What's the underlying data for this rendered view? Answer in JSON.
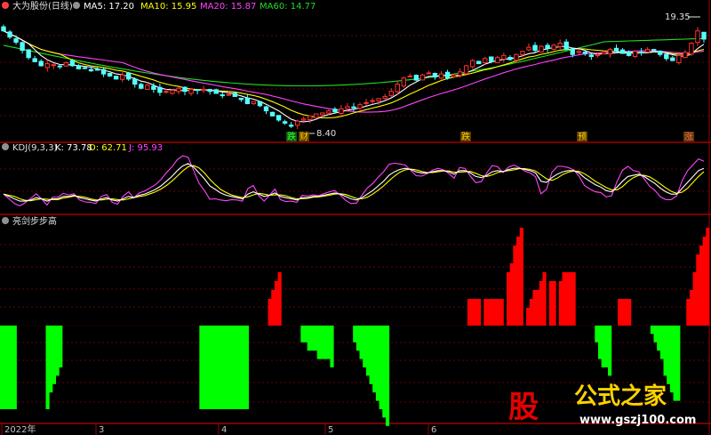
{
  "price_panel": {
    "title": "大为股份(日线)",
    "ma_labels": [
      {
        "text": "MA5: 17.20",
        "color": "#ffffff"
      },
      {
        "text": "MA10: 15.95",
        "color": "#ffff00"
      },
      {
        "text": "MA20: 15.87",
        "color": "#ff44ff"
      },
      {
        "text": "MA60: 14.77",
        "color": "#22dd22"
      }
    ],
    "high_label": "19.35",
    "low_label": "8.40",
    "event_markers": [
      "跌",
      "财",
      "跌",
      "预",
      "涨"
    ]
  },
  "kdj_panel": {
    "title": "KDJ(9,3,3)",
    "labels": [
      {
        "text": "K: 73.78",
        "color": "#ffffff"
      },
      {
        "text": "D: 62.71",
        "color": "#ffff00"
      },
      {
        "text": "J: 95.93",
        "color": "#ff44ff"
      }
    ]
  },
  "indicator_panel": {
    "title": "亮剑步步高"
  },
  "time_axis": [
    "2022年",
    "3",
    "4",
    "5",
    "6"
  ],
  "watermark": {
    "title": "公式之家",
    "url": "www.gszj100.com",
    "logo": "股"
  },
  "colors": {
    "up": "#ff3232",
    "down": "#54ffff",
    "hist_up": "#ff0000",
    "hist_down": "#00ff00",
    "grid": "#8b0000"
  },
  "chart_data": [
    {
      "type": "candlestick",
      "series_name": "大为股份(日线)",
      "x": "trading days, Jan 2022 - Jul 2022",
      "closes": [
        18.2,
        17.6,
        17.1,
        16.3,
        15.6,
        15.2,
        14.8,
        15.0,
        14.9,
        14.7,
        15.1,
        14.8,
        14.5,
        14.6,
        14.3,
        14.4,
        14.0,
        13.8,
        13.5,
        13.9,
        13.5,
        13.0,
        12.6,
        12.9,
        12.5,
        12.2,
        12.3,
        12.4,
        12.6,
        12.3,
        12.5,
        12.4,
        12.5,
        12.3,
        12.1,
        11.9,
        12.0,
        11.8,
        11.5,
        11.1,
        11.3,
        10.9,
        10.4,
        9.9,
        9.5,
        9.2,
        8.9,
        9.4,
        9.6,
        9.9,
        10.1,
        10.2,
        10.4,
        10.3,
        10.6,
        10.8,
        10.7,
        11.0,
        11.2,
        11.4,
        11.6,
        11.8,
        12.3,
        13.0,
        13.6,
        13.8,
        13.4,
        13.9,
        14.1,
        13.7,
        14.0,
        13.6,
        13.9,
        14.2,
        14.8,
        15.3,
        15.0,
        15.5,
        15.2,
        15.6,
        15.8,
        15.4,
        15.9,
        16.2,
        16.6,
        16.3,
        16.7,
        16.5,
        16.8,
        17.0,
        16.4,
        15.9,
        16.2,
        16.0,
        15.7,
        15.9,
        16.1,
        16.4,
        16.2,
        16.0,
        15.8,
        16.2,
        16.1,
        16.4,
        16.3,
        15.9,
        15.5,
        15.3,
        15.8,
        16.1,
        17.0,
        18.2,
        17.4
      ],
      "ma": {
        "MA5": 17.2,
        "MA10": 15.95,
        "MA20": 15.87,
        "MA60": 14.77
      },
      "marked_high": 19.35,
      "marked_low": 8.4
    },
    {
      "type": "line",
      "series": [
        {
          "name": "K",
          "last": 73.78
        },
        {
          "name": "D",
          "last": 62.71
        },
        {
          "name": "J",
          "last": 95.93
        }
      ],
      "params": "9,3,3",
      "k": [
        30,
        26,
        22,
        18,
        18,
        20,
        24,
        22,
        18,
        22,
        22,
        26,
        26,
        28,
        24,
        22,
        20,
        18,
        22,
        24,
        20,
        18,
        22,
        26,
        24,
        28,
        30,
        34,
        38,
        44,
        52,
        60,
        70,
        78,
        82,
        76,
        66,
        56,
        44,
        38,
        32,
        28,
        26,
        24,
        22,
        30,
        34,
        30,
        26,
        28,
        32,
        26,
        24,
        22,
        20,
        24,
        24,
        26,
        26,
        28,
        30,
        32,
        30,
        26,
        22,
        20,
        24,
        30,
        36,
        44,
        52,
        62,
        68,
        72,
        74,
        72,
        68,
        66,
        66,
        68,
        70,
        70,
        68,
        64,
        70,
        70,
        66,
        60,
        58,
        62,
        68,
        70,
        68,
        72,
        74,
        74,
        72,
        70,
        66,
        52,
        50,
        58,
        64,
        68,
        70,
        70,
        66,
        58,
        52,
        46,
        42,
        36,
        34,
        42,
        52,
        60,
        62,
        64,
        60,
        54,
        48,
        40,
        34,
        30,
        30,
        40,
        50,
        60,
        70,
        74
      ]
    },
    {
      "type": "bar",
      "series_name": "亮剑步步高",
      "positive_color": "red",
      "negative_color": "green",
      "values": [
        -10,
        -10,
        -10,
        -10,
        -10,
        0,
        0,
        0,
        0,
        0,
        0,
        0,
        0,
        0,
        -10,
        -8,
        -7,
        -6,
        -5,
        0,
        0,
        0,
        0,
        0,
        0,
        0,
        0,
        0,
        0,
        0,
        0,
        0,
        0,
        0,
        0,
        0,
        0,
        0,
        0,
        0,
        0,
        0,
        0,
        0,
        0,
        0,
        0,
        0,
        0,
        0,
        0,
        0,
        0,
        0,
        0,
        0,
        0,
        0,
        0,
        0,
        0,
        -10,
        -10,
        -10,
        -10,
        -10,
        -10,
        -10,
        -10,
        -10,
        -10,
        -10,
        -10,
        -10,
        -10,
        -10,
        0,
        0,
        0,
        0,
        0,
        0,
        3,
        4,
        5,
        6,
        0,
        0,
        0,
        0,
        0,
        0,
        -2,
        -2,
        -3,
        -3,
        -3,
        -4,
        -4,
        -4,
        -4,
        -5,
        0,
        0,
        0,
        0,
        0,
        0,
        -2,
        -3,
        -4,
        -5,
        -6,
        -7,
        -8,
        -9,
        -10,
        -11,
        -12,
        0,
        0,
        0,
        0,
        0,
        0,
        0,
        0,
        0,
        0,
        0,
        0,
        0,
        0,
        0,
        0,
        0,
        0,
        0,
        0,
        0,
        0,
        0,
        0,
        3,
        3,
        3,
        3,
        0,
        3,
        3,
        3,
        3,
        3,
        3,
        0,
        6,
        7,
        9,
        10,
        11,
        0,
        2,
        3,
        4,
        4,
        5,
        6,
        0,
        5,
        5,
        0,
        5,
        6,
        6,
        6,
        6,
        0,
        0,
        0,
        0,
        0,
        0,
        -2,
        -4,
        -5,
        -5,
        -6,
        0,
        0,
        3,
        3,
        3,
        3,
        0,
        0,
        0,
        0,
        0,
        0,
        -1,
        -2,
        -3,
        -4,
        -6,
        -7,
        -8,
        -9,
        -9,
        0,
        0,
        3,
        4,
        6,
        8,
        9,
        10,
        11
      ]
    }
  ]
}
